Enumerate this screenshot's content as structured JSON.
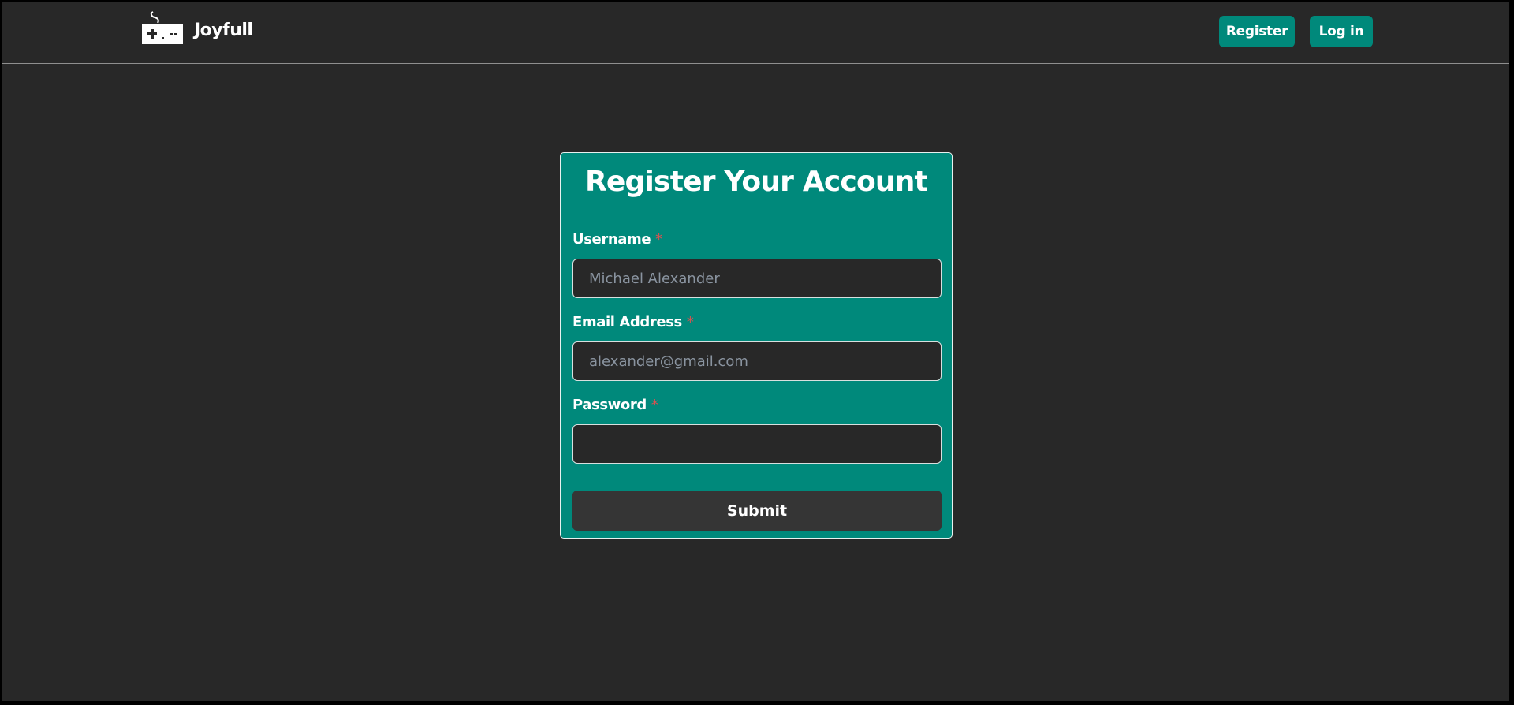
{
  "navbar": {
    "brand_name": "Joyfull",
    "brand_icon": "gamepad-icon",
    "register_label": "Register",
    "login_label": "Log in"
  },
  "form": {
    "title": "Register Your Account",
    "required_marker": "*",
    "username": {
      "label": "Username",
      "placeholder": "Michael Alexander",
      "value": ""
    },
    "email": {
      "label": "Email Address",
      "placeholder": "alexander@gmail.com",
      "value": ""
    },
    "password": {
      "label": "Password",
      "placeholder": "",
      "value": ""
    },
    "submit_label": "Submit"
  },
  "colors": {
    "background": "#282828",
    "accent": "#00897b",
    "required": "#e05050",
    "submit_background": "#353535"
  }
}
